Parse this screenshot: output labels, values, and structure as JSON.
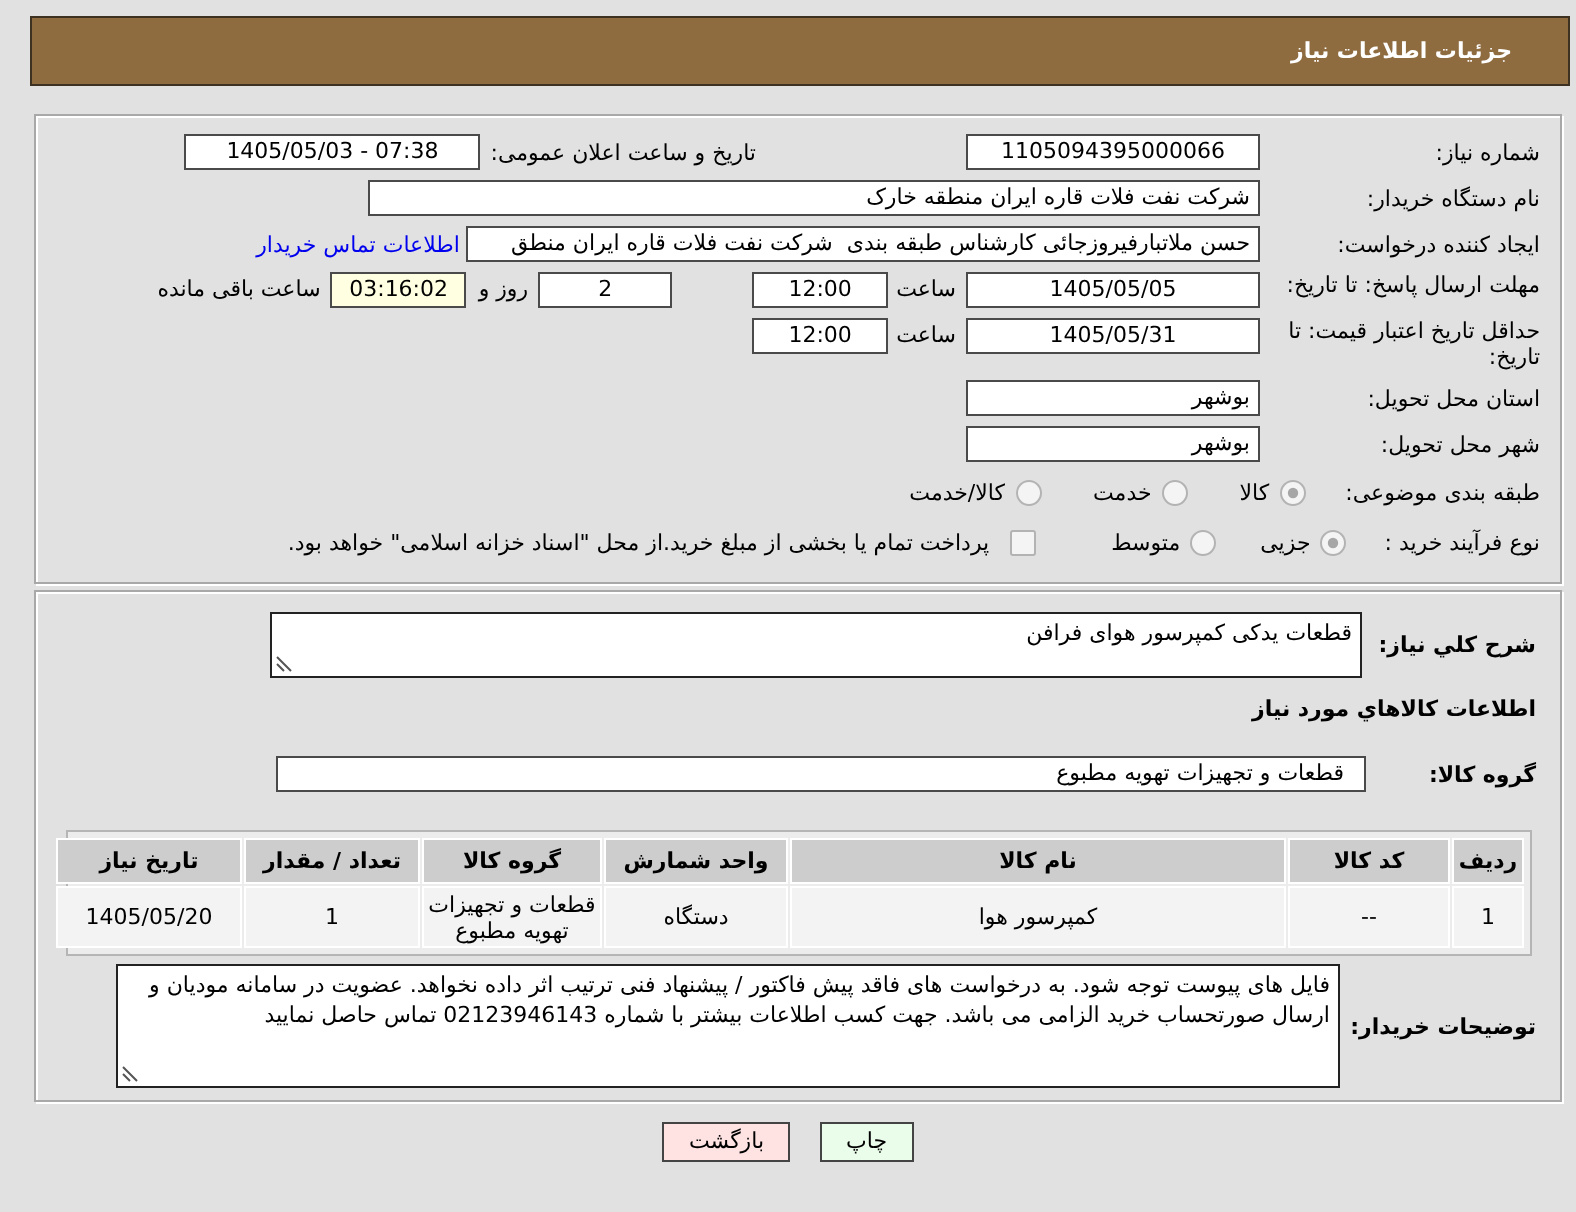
{
  "header": {
    "title": "جزئیات اطلاعات نیاز"
  },
  "details": {
    "need_number": {
      "label": "شماره نیاز:",
      "value": "1105094395000066"
    },
    "announcement": {
      "label": "تاریخ و ساعت اعلان عمومی:",
      "value": "1405/05/03 - 07:38"
    },
    "buyer_org": {
      "label": "نام دستگاه خریدار:",
      "value": "شرکت نفت فلات قاره ایران منطقه خارک"
    },
    "requester": {
      "label": "ایجاد کننده درخواست:",
      "value": "حسن ملاتبارفیروزجائی کارشناس طبقه بندی  شرکت نفت فلات قاره ایران منطق",
      "link": "اطلاعات تماس خریدار"
    },
    "reply_deadline": {
      "label": "مهلت ارسال پاسخ: تا تاریخ:",
      "date": "1405/05/05",
      "time_label": "ساعت",
      "time": "12:00",
      "days": "2",
      "days_label": "روز و",
      "remaining": "03:16:02",
      "remaining_label": "ساعت باقی مانده"
    },
    "price_validity": {
      "label": "حداقل تاریخ اعتبار قیمت: تا تاریخ:",
      "date": "1405/05/31",
      "time_label": "ساعت",
      "time": "12:00"
    },
    "province": {
      "label": "استان محل تحویل:",
      "value": "بوشهر"
    },
    "city": {
      "label": "شهر محل تحویل:",
      "value": "بوشهر"
    },
    "category": {
      "label": "طبقه بندی موضوعی:",
      "options": [
        {
          "label": "کالا",
          "selected": true
        },
        {
          "label": "خدمت",
          "selected": false
        },
        {
          "label": "کالا/خدمت",
          "selected": false
        }
      ]
    },
    "process": {
      "label": "نوع فرآیند خرید :",
      "options": [
        {
          "label": "جزیی",
          "selected": true
        },
        {
          "label": "متوسط",
          "selected": false
        }
      ],
      "treasury": {
        "label": "پرداخت تمام یا بخشی از مبلغ خرید.از محل \"اسناد خزانه اسلامی\" خواهد بود.",
        "checked": false
      }
    }
  },
  "needs": {
    "summary": {
      "label": "شرح کلي نیاز:",
      "value": "قطعات یدکی کمپرسور هوای فرافن"
    },
    "goods_title": "اطلاعات کالاهاي مورد نیاز",
    "goods_group": {
      "label": "گروه کالا:",
      "value": "قطعات و تجهیزات تهویه مطبوع"
    },
    "table": {
      "columns": [
        "ردیف",
        "کد کالا",
        "نام کالا",
        "واحد شمارش",
        "گروه کالا",
        "تعداد / مقدار",
        "تاریخ نیاز"
      ],
      "rows": [
        [
          "1",
          "--",
          "کمپرسور هوا",
          "دستگاه",
          "قطعات و تجهیزات تهویه مطبوع",
          "1",
          "1405/05/20"
        ]
      ]
    },
    "buyer_notes": {
      "label": "توضیحات خریدار:",
      "value": "فایل های پیوست توجه شود. به درخواست های فاقد پیش فاکتور / پیشنهاد فنی ترتیب اثر داده نخواهد. عضویت در سامانه مودیان و ارسال صورتحساب خرید الزامی می باشد. جهت کسب اطلاعات بیشتر با شماره 02123946143 تماس حاصل نمایید"
    }
  },
  "buttons": [
    {
      "kind": "print",
      "label": "چاپ"
    },
    {
      "kind": "back",
      "label": "بازگشت"
    }
  ]
}
